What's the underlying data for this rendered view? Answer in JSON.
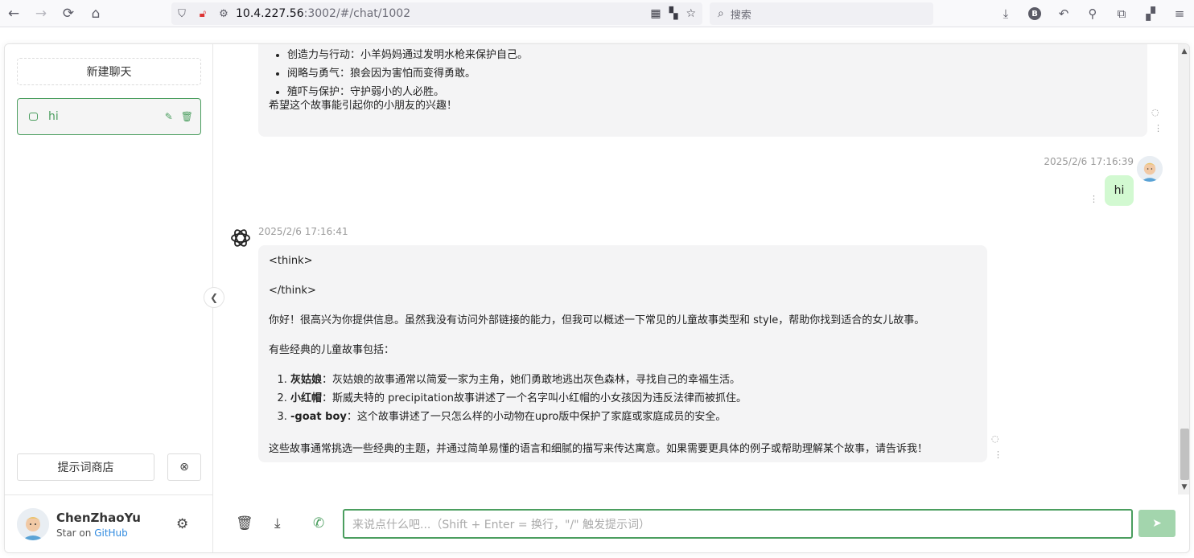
{
  "browser": {
    "url_host": "10.4.227.56",
    "url_rest": ":3002/#/chat/1002",
    "search_placeholder": "搜索",
    "profile_letter": "B"
  },
  "sidebar": {
    "new_chat": "新建聊天",
    "chats": [
      {
        "title": "hi"
      }
    ],
    "prompt_store": "提示词商店",
    "user": {
      "name": "ChenZhaoYu",
      "sub_prefix": "Star on ",
      "sub_link": "GitHub"
    }
  },
  "conversation": {
    "msg1": {
      "bullets": [
        "创造力与行动：小羊妈妈通过发明水枪来保护自己。",
        "阅略与勇气：狼会因为害怕而变得勇敢。",
        "殖吓与保护：守护弱小的人必胜。"
      ],
      "closing": "希望这个故事能引起你的小朋友的兴趣！"
    },
    "user_msg": {
      "time": "2025/2/6 17:16:39",
      "text": "hi"
    },
    "bot_msg": {
      "time": "2025/2/6 17:16:41",
      "think_open": "<think>",
      "think_close": "</think>",
      "intro": "你好！很高兴为你提供信息。虽然我没有访问外部链接的能力，但我可以概述一下常见的儿童故事类型和 style，帮助你找到适合的女儿故事。",
      "list_head": "有些经典的儿童故事包括：",
      "items": [
        {
          "bold": "灰姑娘",
          "text": "：灰姑娘的故事通常以简爱一家为主角，她们勇敢地逃出灰色森林，寻找自己的幸福生活。"
        },
        {
          "bold": "小红帽",
          "text": "：斯威夫特的 precipitation故事讲述了一个名字叫小红帽的小女孩因为违反法律而被抓住。"
        },
        {
          "bold": "-goat boy",
          "text": "：这个故事讲述了一只怎么样的小动物在upro版中保护了家庭或家庭成员的安全。"
        }
      ],
      "closing": "这些故事通常挑选一些经典的主题，并通过简单易懂的语言和细腻的描写来传达寓意。如果需要更具体的例子或帮助理解某个故事，请告诉我！"
    }
  },
  "input": {
    "placeholder": "来说点什么吧...（Shift + Enter = 换行，\"/\" 触发提示词）"
  },
  "colors": {
    "accent": "#4b9e5f",
    "user_bubble": "#d2f9d1",
    "send_disabled": "#a3d5ad"
  }
}
